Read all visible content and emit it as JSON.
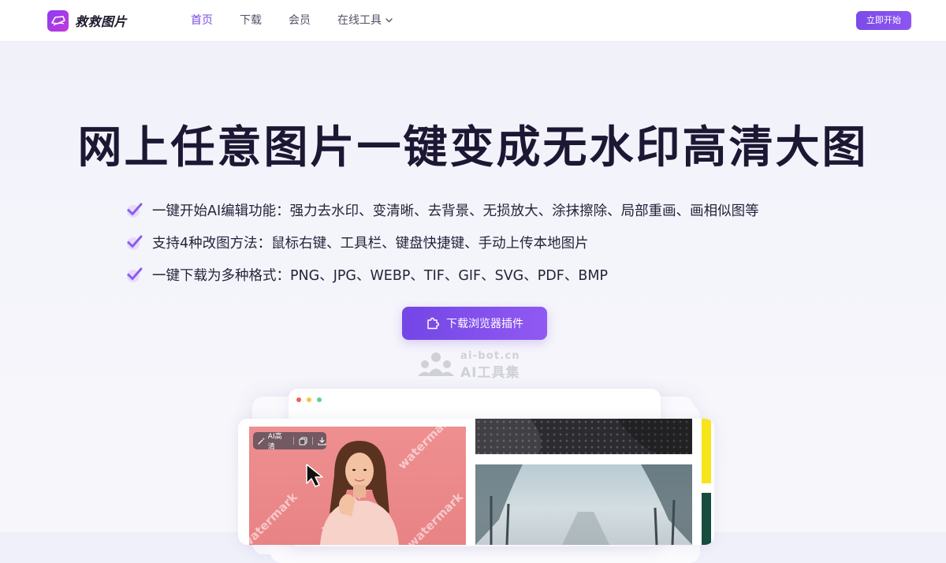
{
  "nav": {
    "logo_text": "救救图片",
    "items": [
      {
        "label": "首页",
        "active": true
      },
      {
        "label": "下载",
        "active": false
      },
      {
        "label": "会员",
        "active": false
      },
      {
        "label": "在线工具",
        "active": false,
        "dropdown": true
      }
    ],
    "cta_label": "立即开始"
  },
  "hero": {
    "title": "网上任意图片一键变成无水印高清大图",
    "features": [
      "一键开始AI编辑功能：强力去水印、变清晰、去背景、无损放大、涂抹擦除、局部重画、画相似图等",
      "支持4种改图方法：鼠标右键、工具栏、键盘快捷键、手动上传本地图片",
      "一键下载为多种格式：PNG、JPG、WEBP、TIF、GIF、SVG、PDF、BMP"
    ],
    "cta_label": "下载浏览器插件"
  },
  "watermark_logo": {
    "url": "ai-bot.cn",
    "name": "AI工具集"
  },
  "mockup": {
    "toolbar_label": "AI高清",
    "watermark_word": "watermark"
  },
  "colors": {
    "accent": "#7a4ce6",
    "accent_light": "#9159f2",
    "title": "#1c1733",
    "mockup_pink": "#ee8f90",
    "strip_yellow": "#f7e41a",
    "strip_green": "#174d3e"
  },
  "icons": {
    "logo": "logo-icon",
    "dropdown": "chevron-down-icon",
    "feature": "check-icon",
    "plugin": "puzzle-icon",
    "magic": "magic-wand-icon",
    "copy": "copy-icon",
    "download": "download-icon",
    "cursor": "cursor-arrow-icon"
  }
}
